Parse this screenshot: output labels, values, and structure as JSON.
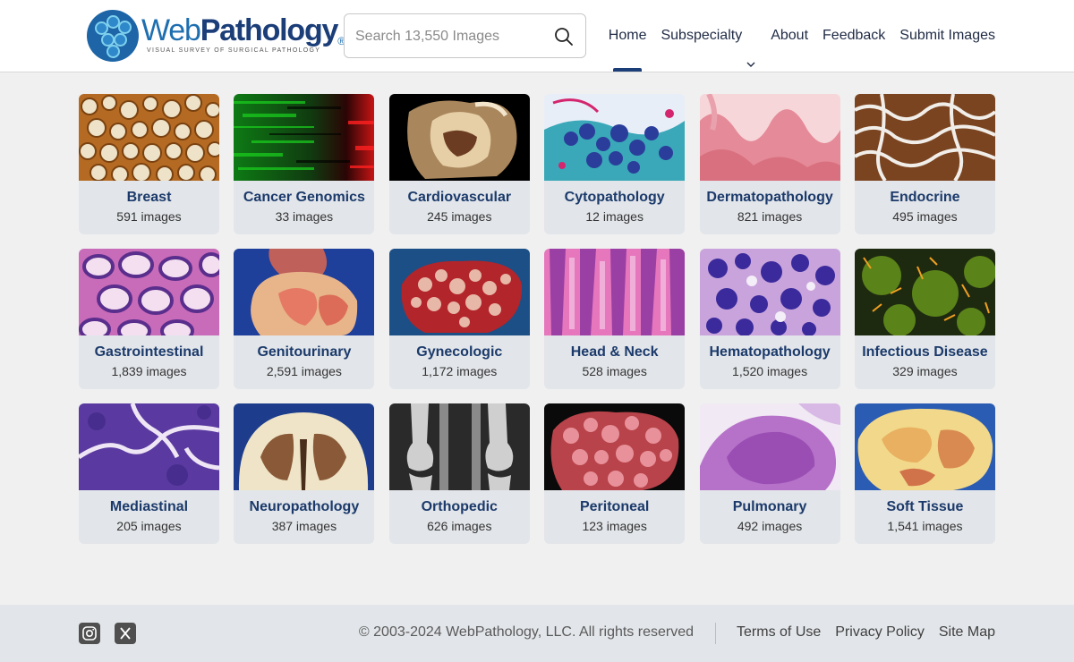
{
  "brand": {
    "name_part1": "Web",
    "name_part2": "Pathology",
    "registered": "®",
    "tagline": "VISUAL SURVEY OF SURGICAL PATHOLOGY",
    "colors": {
      "primary": "#1b3e79",
      "secondary": "#1e6fb0",
      "accent": "#7fd1ee"
    }
  },
  "search": {
    "placeholder": "Search 13,550 Images",
    "value": "",
    "icon": "search-icon"
  },
  "nav": {
    "home": "Home",
    "subspecialty": "Subspecialty",
    "about": "About",
    "feedback": "Feedback",
    "submit": "Submit Images",
    "active": "home"
  },
  "categories": [
    {
      "title": "Breast",
      "count": "591 images"
    },
    {
      "title": "Cancer Genomics",
      "count": "33 images"
    },
    {
      "title": "Cardiovascular",
      "count": "245 images"
    },
    {
      "title": "Cytopathology",
      "count": "12 images"
    },
    {
      "title": "Dermatopathology",
      "count": "821 images"
    },
    {
      "title": "Endocrine",
      "count": "495 images"
    },
    {
      "title": "Gastrointestinal",
      "count": "1,839 images"
    },
    {
      "title": "Genitourinary",
      "count": "2,591 images"
    },
    {
      "title": "Gynecologic",
      "count": "1,172 images"
    },
    {
      "title": "Head & Neck",
      "count": "528 images"
    },
    {
      "title": "Hematopathology",
      "count": "1,520 images"
    },
    {
      "title": "Infectious Disease",
      "count": "329 images"
    },
    {
      "title": "Mediastinal",
      "count": "205 images"
    },
    {
      "title": "Neuropathology",
      "count": "387 images"
    },
    {
      "title": "Orthopedic",
      "count": "626 images"
    },
    {
      "title": "Peritoneal",
      "count": "123 images"
    },
    {
      "title": "Pulmonary",
      "count": "492 images"
    },
    {
      "title": "Soft Tissue",
      "count": "1,541 images"
    }
  ],
  "footer": {
    "social": [
      "instagram-icon",
      "x-icon"
    ],
    "copyright": "© 2003-2024 WebPathology, LLC. All rights reserved",
    "terms": "Terms of Use",
    "privacy": "Privacy Policy",
    "sitemap": "Site Map"
  }
}
